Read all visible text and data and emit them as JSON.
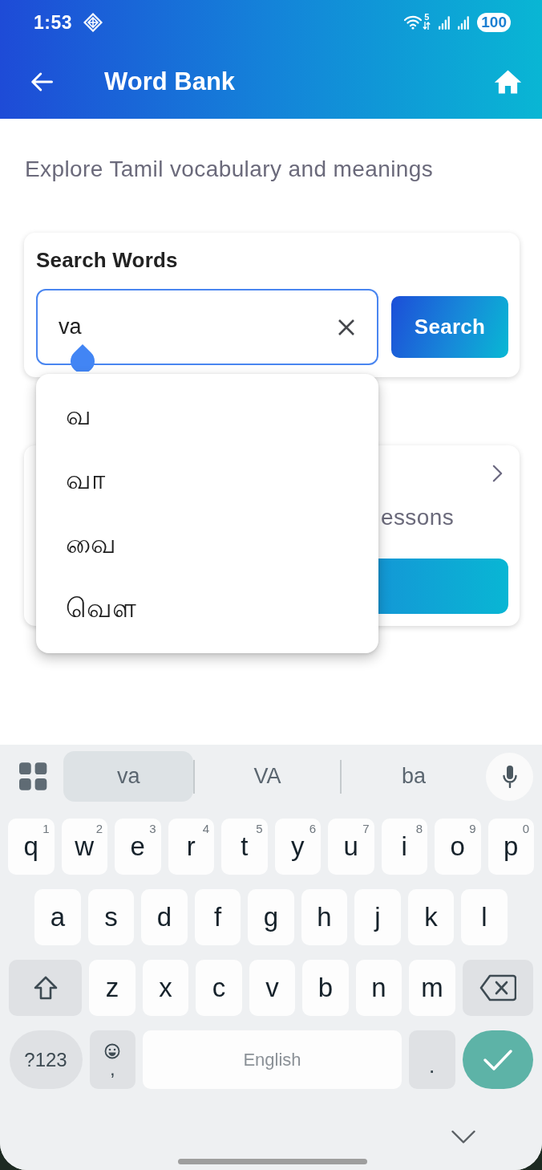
{
  "status_bar": {
    "time": "1:53",
    "wifi_label": "5",
    "battery": "100"
  },
  "app_bar": {
    "title": "Word Bank"
  },
  "subtitle": "Explore Tamil vocabulary and meanings",
  "search_card": {
    "title": "Search Words",
    "query": "va",
    "button": "Search"
  },
  "autocomplete": [
    "வ",
    "வா",
    "வை",
    "வெள"
  ],
  "lesson_card": {
    "text": "essons"
  },
  "keyboard": {
    "suggestions": [
      {
        "text": "va",
        "selected": true
      },
      {
        "text": "VA",
        "selected": false
      },
      {
        "text": "ba",
        "selected": false
      }
    ],
    "rows": [
      {
        "keys": [
          {
            "kind": "letter",
            "label": "q",
            "hint": "1"
          },
          {
            "kind": "letter",
            "label": "w",
            "hint": "2"
          },
          {
            "kind": "letter",
            "label": "e",
            "hint": "3"
          },
          {
            "kind": "letter",
            "label": "r",
            "hint": "4"
          },
          {
            "kind": "letter",
            "label": "t",
            "hint": "5"
          },
          {
            "kind": "letter",
            "label": "y",
            "hint": "6"
          },
          {
            "kind": "letter",
            "label": "u",
            "hint": "7"
          },
          {
            "kind": "letter",
            "label": "i",
            "hint": "8"
          },
          {
            "kind": "letter",
            "label": "o",
            "hint": "9"
          },
          {
            "kind": "letter",
            "label": "p",
            "hint": "0"
          }
        ]
      },
      {
        "keys": [
          {
            "kind": "letter",
            "label": "a"
          },
          {
            "kind": "letter",
            "label": "s"
          },
          {
            "kind": "letter",
            "label": "d"
          },
          {
            "kind": "letter",
            "label": "f"
          },
          {
            "kind": "letter",
            "label": "g"
          },
          {
            "kind": "letter",
            "label": "h"
          },
          {
            "kind": "letter",
            "label": "j"
          },
          {
            "kind": "letter",
            "label": "k"
          },
          {
            "kind": "letter",
            "label": "l"
          }
        ]
      },
      {
        "keys": [
          {
            "kind": "shift"
          },
          {
            "kind": "letter",
            "label": "z"
          },
          {
            "kind": "letter",
            "label": "x"
          },
          {
            "kind": "letter",
            "label": "c"
          },
          {
            "kind": "letter",
            "label": "v"
          },
          {
            "kind": "letter",
            "label": "b"
          },
          {
            "kind": "letter",
            "label": "n"
          },
          {
            "kind": "letter",
            "label": "m"
          },
          {
            "kind": "backspace"
          }
        ]
      },
      {
        "keys": [
          {
            "kind": "symbols",
            "label": "?123"
          },
          {
            "kind": "emoji",
            "label": ","
          },
          {
            "kind": "space",
            "label": "English"
          },
          {
            "kind": "punct",
            "label": "."
          },
          {
            "kind": "enter"
          }
        ]
      }
    ]
  }
}
